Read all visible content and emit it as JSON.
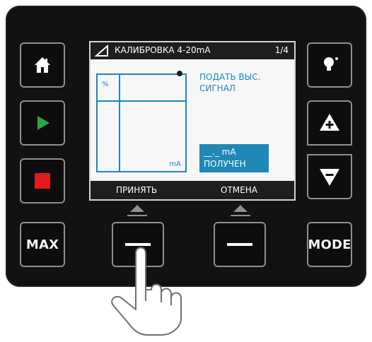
{
  "device": {
    "left_buttons": [
      {
        "id": "home",
        "icon": "home-icon",
        "color": "#ffffff"
      },
      {
        "id": "run",
        "icon": "play-icon",
        "color": "#28a745"
      },
      {
        "id": "stop",
        "icon": "stop-icon",
        "color": "#e11b1b"
      },
      {
        "id": "max",
        "label": "MAX"
      }
    ],
    "right_buttons": [
      {
        "id": "light",
        "icon": "bulb-icon"
      },
      {
        "id": "increase",
        "icon": "plus-icon"
      },
      {
        "id": "decrease",
        "icon": "minus-icon"
      },
      {
        "id": "mode",
        "label": "MODE"
      }
    ],
    "softkeys": [
      {
        "id": "accept",
        "icon": "minus-bar-icon"
      },
      {
        "id": "cancel",
        "icon": "minus-bar-icon"
      }
    ]
  },
  "screen": {
    "title": "КАЛИБРОВКА 4-20mA",
    "page": "1/4",
    "instruction": [
      "ПОДАТЬ ВЫС.",
      "СИГНАЛ"
    ],
    "graph_label_y": "%",
    "graph_label_x": "mA",
    "value_box": {
      "line1": "__._ mA",
      "line2": "ПОЛУЧЕН"
    },
    "footer": {
      "left": "ПРИНЯТЬ",
      "right": "ОТМЕНА"
    }
  },
  "colors": {
    "panel": "#121212",
    "screen_bg": "#f7f7f7",
    "accent_blue": "#1e88b6"
  }
}
